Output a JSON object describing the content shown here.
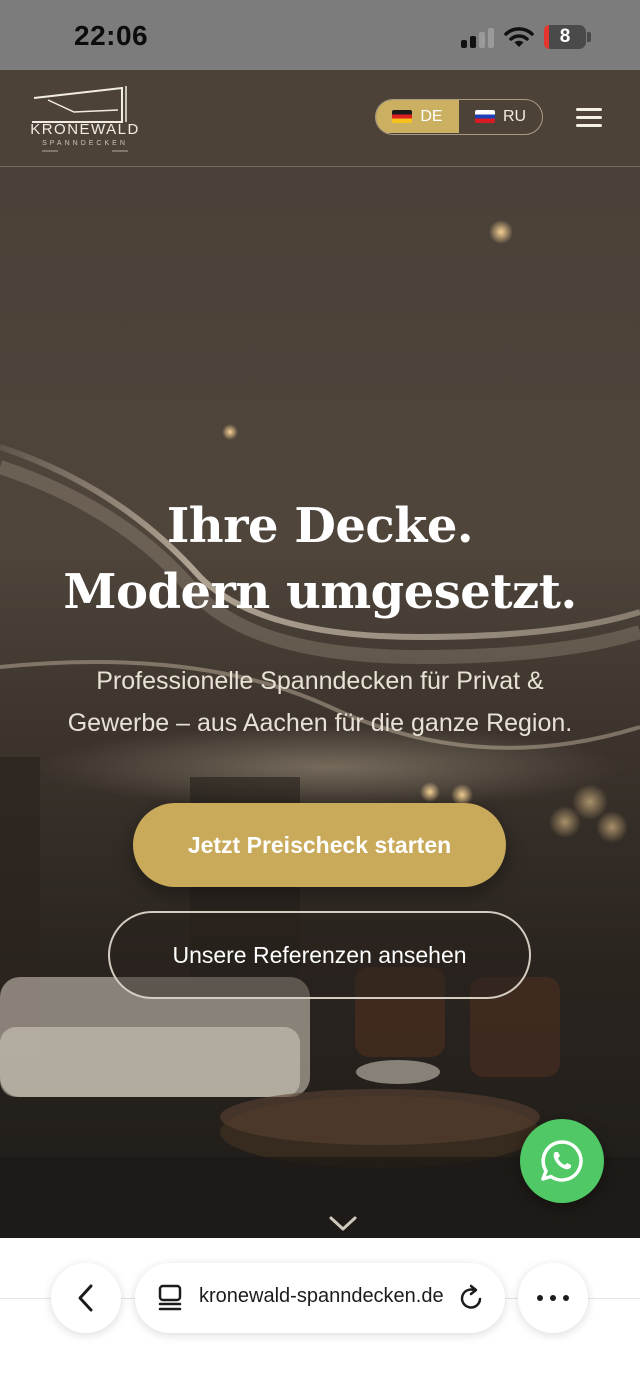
{
  "status_bar": {
    "time": "22:06",
    "battery_level": "8",
    "icons": [
      "cellular-signal-icon",
      "wifi-icon",
      "battery-icon"
    ]
  },
  "header": {
    "logo_name": "KRONEWALD",
    "logo_tagline": "SPANNDECKEN",
    "languages": [
      {
        "code": "DE",
        "flag": "germany-flag-icon",
        "active": true
      },
      {
        "code": "RU",
        "flag": "russia-flag-icon",
        "active": false
      }
    ],
    "menu_icon": "hamburger-menu-icon"
  },
  "hero": {
    "title_line1": "Ihre Decke.",
    "title_line2": "Modern umgesetzt.",
    "subtitle_line1": "Professionelle Spanndecken für Privat &",
    "subtitle_line2": "Gewerbe – aus Aachen für die ganze Region.",
    "primary_cta": "Jetzt Preischeck starten",
    "secondary_cta": "Unsere Referenzen ansehen",
    "scroll_icon": "chevron-down-icon"
  },
  "floating": {
    "whatsapp_icon": "whatsapp-icon"
  },
  "browser": {
    "url": "kronewald-spanndecken.de",
    "icons": [
      "back-arrow-icon",
      "tabs-icon",
      "reload-icon",
      "more-options-icon"
    ]
  },
  "colors": {
    "accent_gold": "#c8aa5a",
    "header_bg": "#4d4237",
    "whatsapp_green": "#4fc865"
  }
}
